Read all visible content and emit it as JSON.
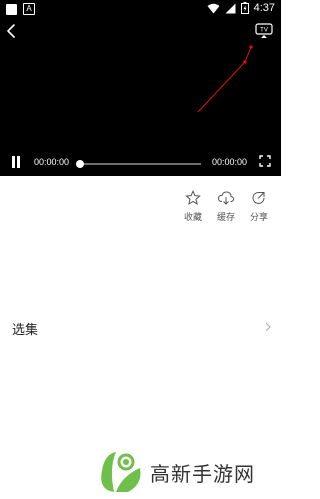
{
  "status_bar": {
    "time": "4:37",
    "notification_icons": [
      "square-notification-icon",
      "a-notification-icon"
    ],
    "system_icons": [
      "wifi-icon",
      "signal-icon",
      "battery-icon"
    ]
  },
  "player": {
    "back_icon": "back-arrow-icon",
    "tv_icon": "tv-cast-icon",
    "tv_text": "TV",
    "current_time": "00:00:00",
    "total_time": "00:00:00",
    "progress": 0.0,
    "state": "playing"
  },
  "actions": [
    {
      "label": "收藏",
      "icon": "star-icon"
    },
    {
      "label": "缓存",
      "icon": "cloud-download-icon"
    },
    {
      "label": "分享",
      "icon": "share-icon"
    }
  ],
  "episodes": {
    "title": "选集"
  },
  "watermark": {
    "text": "高新手游网"
  },
  "colors": {
    "player_bg": "#000000",
    "annotation_red": "#e01010",
    "logo_green": "#6ec04a"
  }
}
